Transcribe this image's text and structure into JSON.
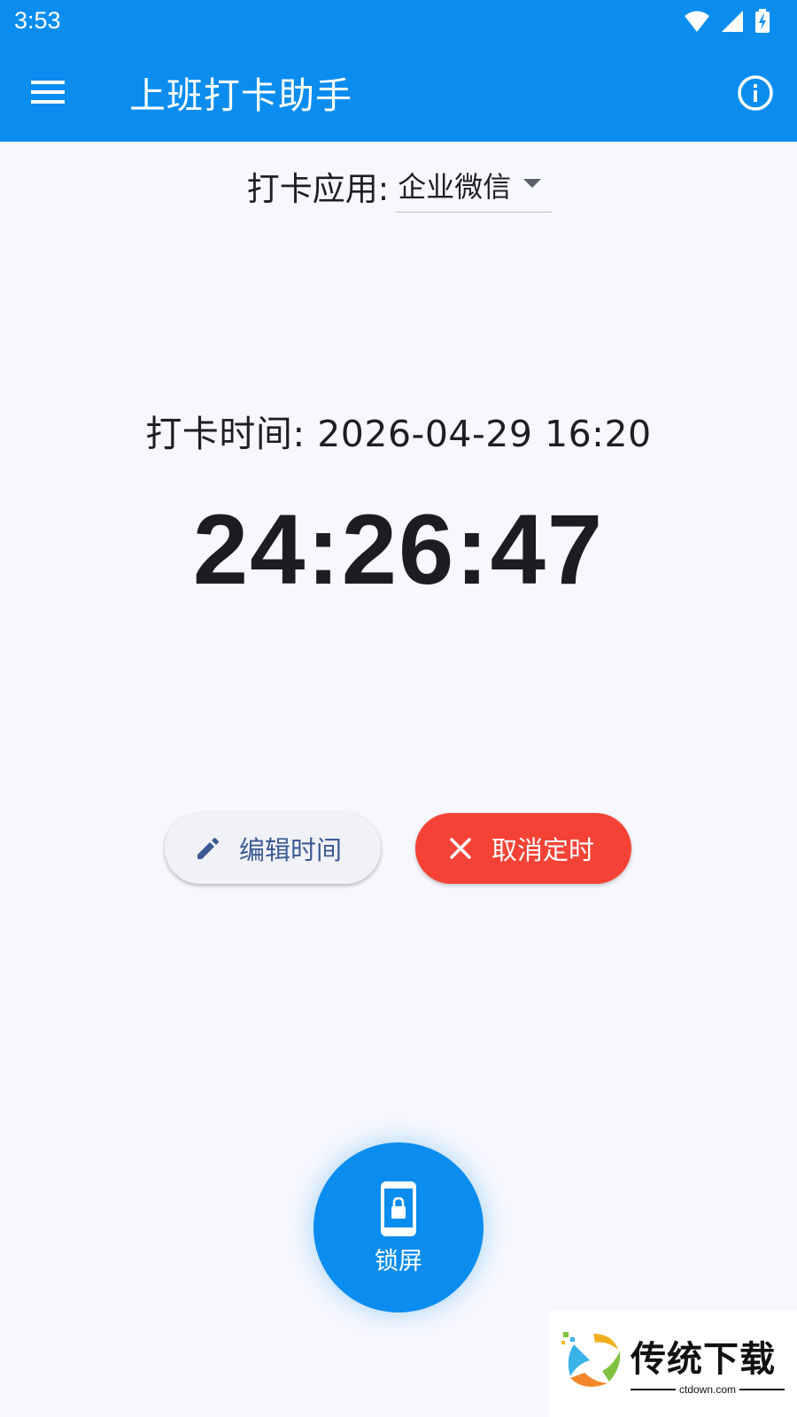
{
  "status_bar": {
    "time": "3:53",
    "icons": [
      "wifi-icon",
      "signal-icon",
      "battery-charging-icon"
    ]
  },
  "app_bar": {
    "title": "上班打卡助手",
    "menu_icon": "menu-icon",
    "info_icon": "info-icon",
    "color": "#0a8def"
  },
  "app_selector": {
    "label": "打卡应用:",
    "selected": "企业微信"
  },
  "punch": {
    "time_text": "打卡时间: 2026-04-29 16:20",
    "countdown": "24:26:47"
  },
  "buttons": {
    "edit_label": "编辑时间",
    "cancel_label": "取消定时",
    "cancel_color": "#f44336"
  },
  "fab": {
    "label": "锁屏",
    "icon": "phone-lock-icon"
  },
  "watermark": {
    "brand": "传统下载",
    "domain": "ctdown.com"
  }
}
